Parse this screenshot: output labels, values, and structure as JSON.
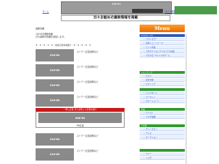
{
  "header": {
    "left_link": "ホーム",
    "right_link": "サイト概要",
    "top_banner_label": "468*60",
    "site_title": "日々お勧めの最新情報を掲載"
  },
  "main": {
    "intro_lines": [
      "最新情報",
      "1月15日更新情報",
      "日々最新の情報を追加します。"
    ],
    "separator": "★・★・★・★・★・最新広告情報紹介・★・★・★・★・★",
    "ads": [
      {
        "label": "234*60",
        "text": "ストアー広告説明など"
      },
      {
        "label": "234*60",
        "text": "ストアー広告説明など"
      },
      {
        "label": "234*60",
        "text": "ストアー広告説明など"
      },
      {
        "label": "234*60",
        "text": "ストアー広告説明など"
      },
      {
        "label": "234*60",
        "text": "ストアー広告説明など"
      }
    ],
    "red_bar_text": "一押し広告 または新しい広告の紹介",
    "wide_ad_label": "468*60",
    "wide_ad_caption": "PR広告",
    "ads_bottom": [
      {
        "label": "234*60",
        "text": "ストアー広告説明など"
      },
      {
        "label": "234*60",
        "text": "ストアー広告説明など"
      }
    ]
  },
  "sidebar": {
    "menu_title": "Menu",
    "sections": [
      {
        "title": "Amazon Link",
        "color": "#2d58b8",
        "items": [
          "ベストセラー",
          "新着ニューリリース",
          "ヒット商品",
          "人気ギフトエレクトロニクス商品",
          "人気ホビー&トイス&ゲーム"
        ]
      },
      {
        "title": "ショッピング",
        "color": "#2e9b2e",
        "items": [
          "ビルド",
          "楽天市場",
          "ビクトリア"
        ]
      },
      {
        "title": "",
        "color": "#2e9b2e",
        "items": [
          "ジャパネット",
          "ユーキャン",
          "タワーレコード"
        ]
      },
      {
        "title": "家電",
        "color": "#2e9b2e",
        "items": [
          "パソコン",
          "ヤマダ電機"
        ]
      },
      {
        "title": "その他",
        "color": "#2e9b2e",
        "items": [
          "チャンピオン",
          "テレビ",
          "オークション"
        ]
      },
      {
        "title": "",
        "color": "#2e9b2e",
        "items": [
          "ヤフー",
          "ドコモ"
        ]
      }
    ]
  }
}
